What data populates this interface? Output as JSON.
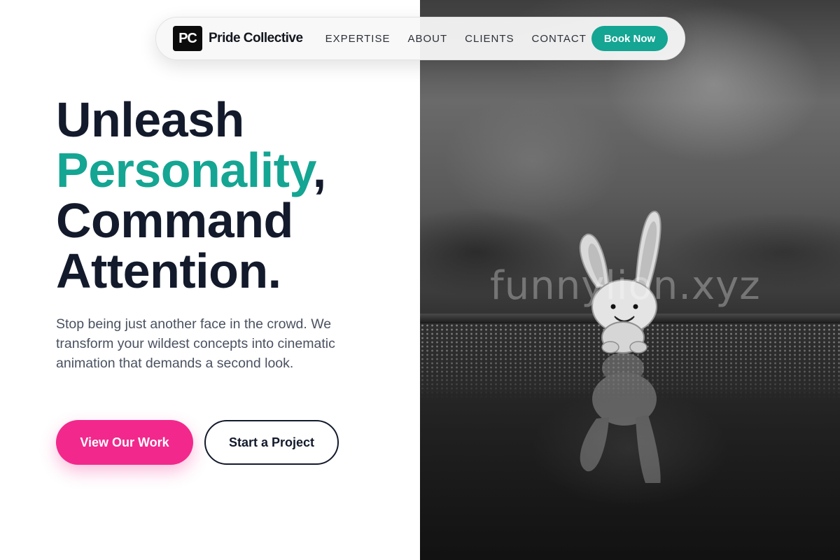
{
  "nav": {
    "logo_mark": "PC",
    "brand_name": "Pride Collective",
    "links": [
      {
        "label": "EXPERTISE"
      },
      {
        "label": "ABOUT"
      },
      {
        "label": "CLIENTS"
      },
      {
        "label": "CONTACT"
      }
    ],
    "cta_label": "Book Now"
  },
  "hero": {
    "headline_line1": "Unleash",
    "headline_accent": "Personality",
    "headline_comma": ",",
    "headline_line3": "Command",
    "headline_line4": "Attention.",
    "subcopy": "Stop being just another face in the crowd. We transform your wildest concepts into cinematic animation that demands a second look.",
    "primary_cta": "View Our Work",
    "secondary_cta": "Start a Project"
  },
  "image": {
    "watermark": "funnylion.xyz"
  },
  "colors": {
    "accent_teal": "#14a593",
    "accent_pink": "#f2288c",
    "heading_dark": "#131a2b"
  }
}
